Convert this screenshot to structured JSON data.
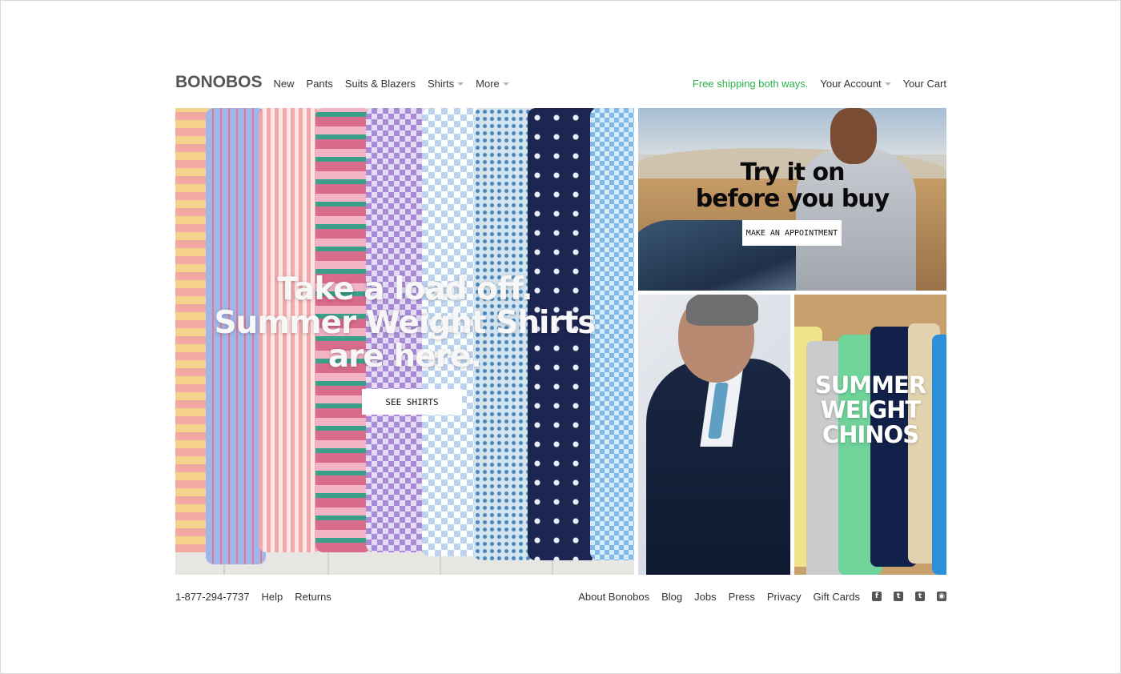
{
  "header": {
    "logo": "BONOBOS",
    "nav": {
      "new": "New",
      "pants": "Pants",
      "suits": "Suits & Blazers",
      "shirts": "Shirts",
      "more": "More"
    },
    "promo": "Free shipping both ways.",
    "account": "Your Account",
    "cart": "Your Cart"
  },
  "hero": {
    "line1": "Take a load off.",
    "line2": "Summer Weight Shirts",
    "line3": "are here.",
    "button": "SEE SHIRTS"
  },
  "tryon": {
    "line1": "Try it on",
    "line2": "before you buy",
    "button": "MAKE AN APPOINTMENT"
  },
  "chinos": {
    "line1": "SUMMER",
    "line2": "WEIGHT",
    "line3": "CHINOS"
  },
  "footer": {
    "phone": "1-877-294-7737",
    "help": "Help",
    "returns": "Returns",
    "about": "About Bonobos",
    "blog": "Blog",
    "jobs": "Jobs",
    "press": "Press",
    "privacy": "Privacy",
    "gift_cards": "Gift Cards",
    "social": [
      "facebook-icon",
      "twitter-icon",
      "tumblr-icon",
      "instagram-icon"
    ]
  },
  "colors": {
    "promo_green": "#2cb34a",
    "text": "#333333"
  }
}
